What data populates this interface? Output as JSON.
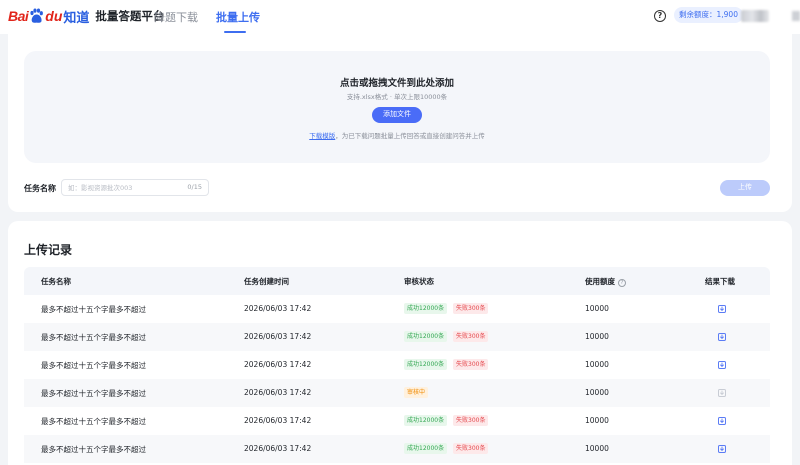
{
  "header": {
    "logo_bai": "Bai",
    "logo_du": "du",
    "logo_zd": "知道",
    "platform_name": "批量答题平台",
    "tabs": [
      {
        "label": "降题下载",
        "active": false
      },
      {
        "label": "批量上传",
        "active": true
      }
    ],
    "help_icon": "question-circle-icon",
    "quota_label": "剩余额度：",
    "quota_value": "1,900"
  },
  "upload": {
    "title": "点击或拖拽文件到此处添加",
    "subtitle": "支持.xlsx格式 · 单次上限10000条",
    "add_button": "添加文件",
    "hint_link": "下载模版",
    "hint_rest": "，为已下载问题批量上传回答或直接创建问答并上传",
    "task_label": "任务名称",
    "task_placeholder": "如：影视资源批次003",
    "task_value": "",
    "task_count": "0/15",
    "upload_button": "上传"
  },
  "records": {
    "title": "上传记录",
    "columns": [
      "任务名称",
      "任务创建时间",
      "审核状态",
      "使用额度",
      "结果下载"
    ],
    "rows": [
      {
        "name": "最多不超过十五个字最多不超过",
        "time": "2026/06/03 17:42",
        "status": "done",
        "ok": "成功12000条",
        "fail": "失败300条",
        "quota": "10000",
        "downloadable": true
      },
      {
        "name": "最多不超过十五个字最多不超过",
        "time": "2026/06/03 17:42",
        "status": "done",
        "ok": "成功12000条",
        "fail": "失败300条",
        "quota": "10000",
        "downloadable": true
      },
      {
        "name": "最多不超过十五个字最多不超过",
        "time": "2026/06/03 17:42",
        "status": "done",
        "ok": "成功12000条",
        "fail": "失败300条",
        "quota": "10000",
        "downloadable": true
      },
      {
        "name": "最多不超过十五个字最多不超过",
        "time": "2026/06/03 17:42",
        "status": "pending",
        "pending": "审核中",
        "quota": "10000",
        "downloadable": false
      },
      {
        "name": "最多不超过十五个字最多不超过",
        "time": "2026/06/03 17:42",
        "status": "done",
        "ok": "成功12000条",
        "fail": "失败300条",
        "quota": "10000",
        "downloadable": true
      },
      {
        "name": "最多不超过十五个字最多不超过",
        "time": "2026/06/03 17:42",
        "status": "done",
        "ok": "成功12000条",
        "fail": "失败300条",
        "quota": "10000",
        "downloadable": true
      }
    ]
  },
  "colors": {
    "accent": "#3e6ef0",
    "success": "#34a853",
    "fail": "#e5484d",
    "pending": "#f08a00",
    "brand_red": "#e1251b"
  }
}
